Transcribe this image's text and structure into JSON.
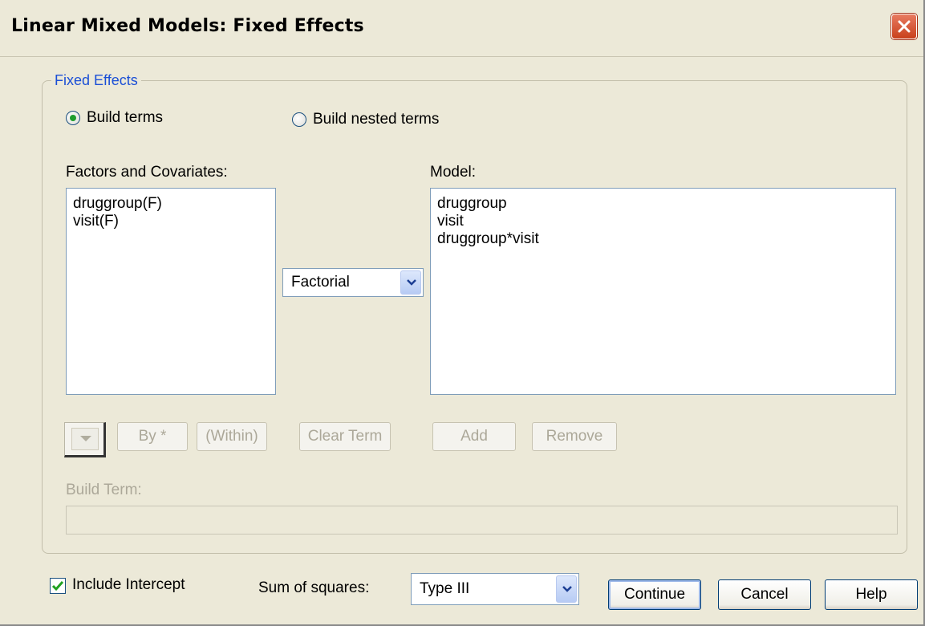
{
  "window": {
    "title": "Linear Mixed Models: Fixed Effects",
    "close_icon": "close-icon"
  },
  "fixed_effects": {
    "legend": "Fixed Effects",
    "radio_build_terms": "Build terms",
    "radio_build_nested": "Build nested terms",
    "selected_radio": "Build terms"
  },
  "factors": {
    "label": "Factors and Covariates:",
    "items": [
      "druggroup(F)",
      "visit(F)"
    ]
  },
  "model": {
    "label": "Model:",
    "items": [
      "druggroup",
      "visit",
      "druggroup*visit"
    ]
  },
  "term_type": {
    "value": "Factorial"
  },
  "buttons": {
    "by": "By *",
    "within": "(Within)",
    "clear_term": "Clear Term",
    "add": "Add",
    "remove": "Remove",
    "continue": "Continue",
    "cancel": "Cancel",
    "help": "Help"
  },
  "build_term": {
    "label": "Build Term:",
    "value": ""
  },
  "intercept": {
    "label": "Include Intercept",
    "checked": true
  },
  "sum_of_squares": {
    "label": "Sum of squares:",
    "value": "Type III"
  },
  "colors": {
    "legend_blue": "#1b4fd6",
    "dialog_bg": "#ece9d8",
    "disabled_text": "#aca899"
  }
}
